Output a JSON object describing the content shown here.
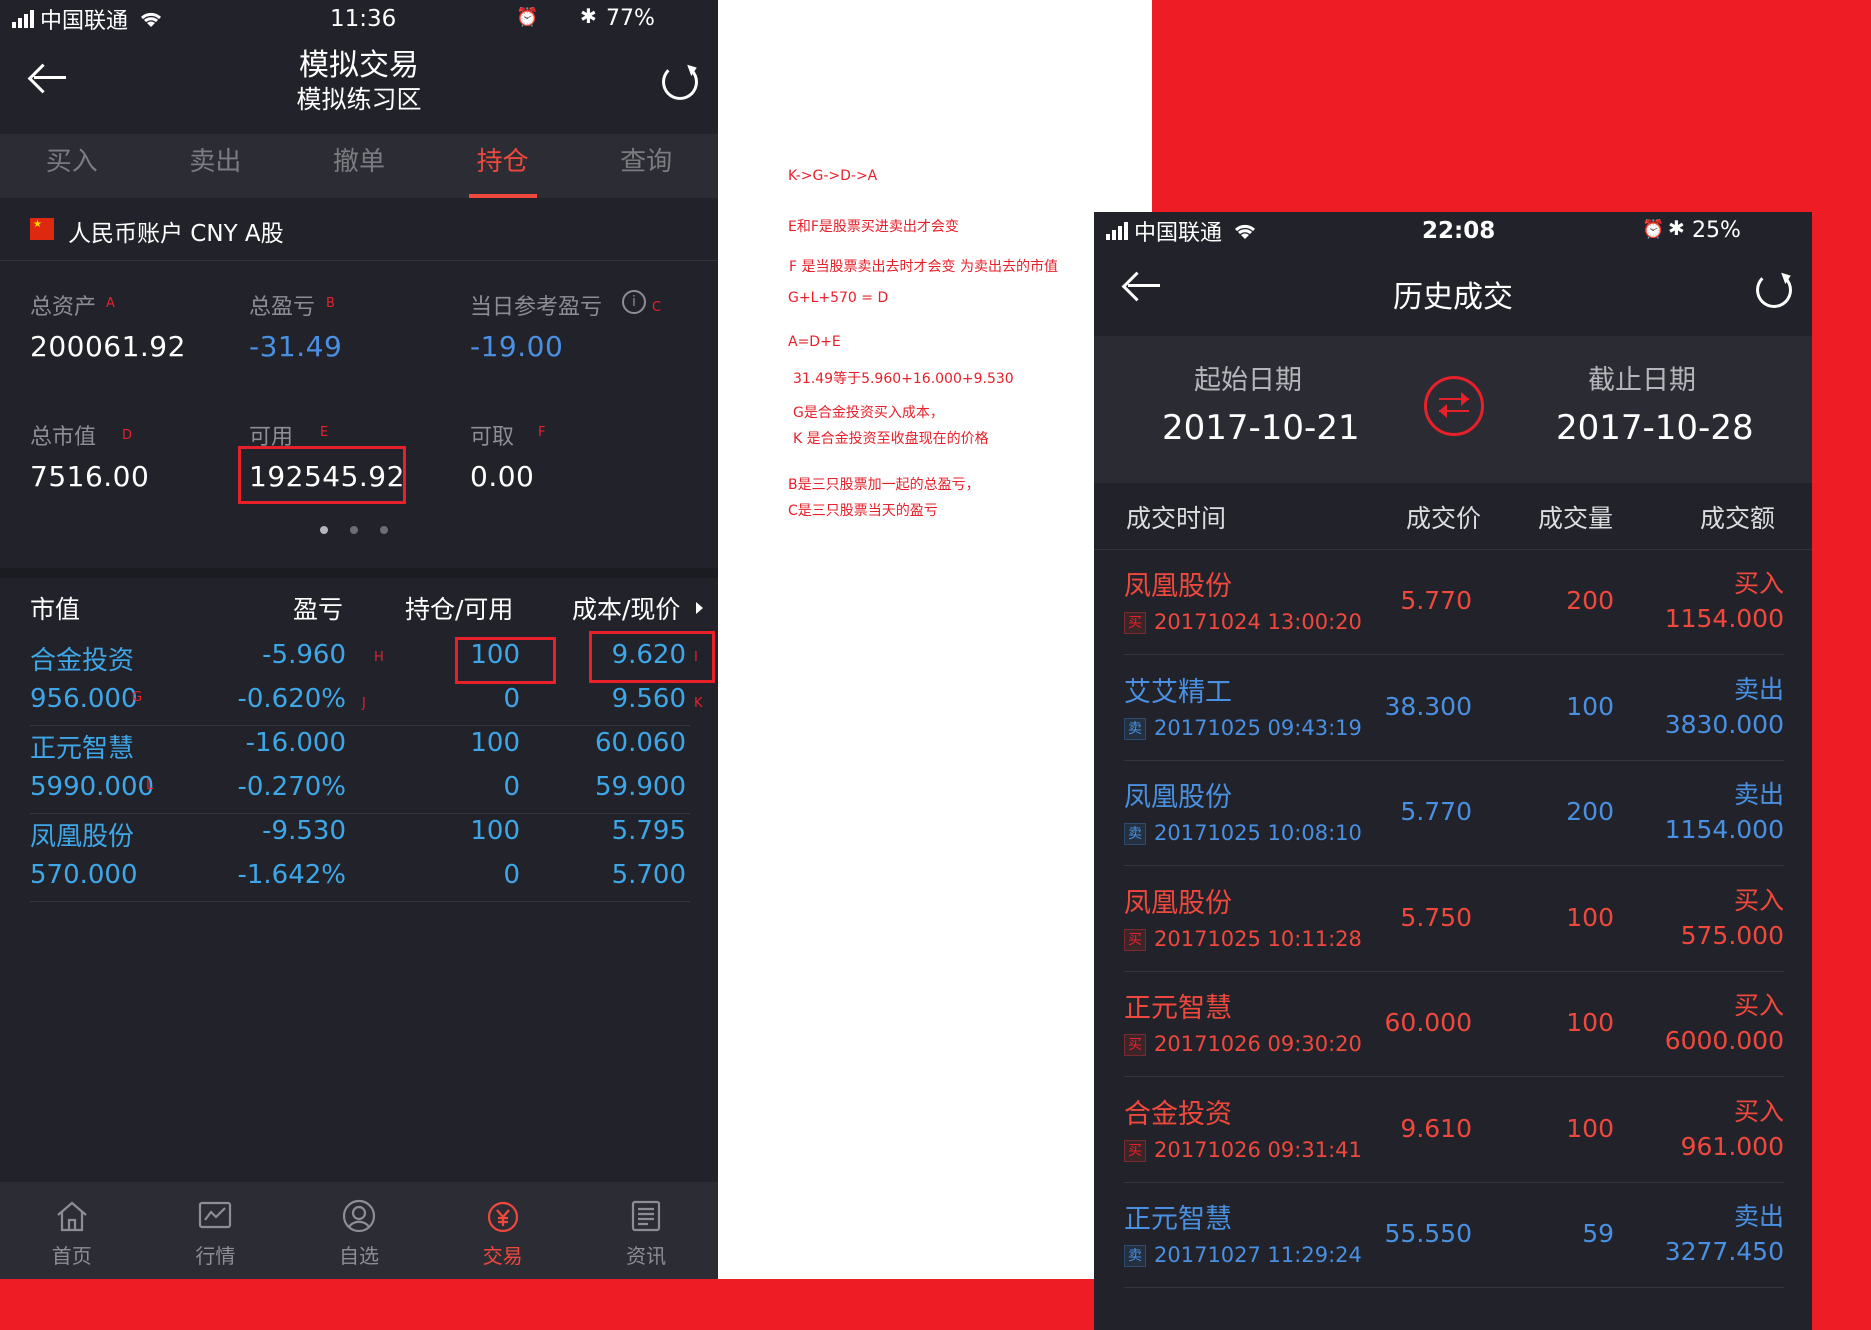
{
  "left": {
    "status": {
      "carrier": "中国联通",
      "time": "11:36",
      "battery": "77%",
      "battery_level": 0.77
    },
    "title": "模拟交易",
    "subtitle": "模拟练习区",
    "tabs": [
      "买入",
      "卖出",
      "撤单",
      "持仓",
      "查询"
    ],
    "active_tab": 3,
    "account": "人民币账户 CNY A股",
    "summary": {
      "total_assets_label": "总资产",
      "total_assets_mark": "A",
      "total_assets": "200061.92",
      "total_pl_label": "总盈亏",
      "total_pl_mark": "B",
      "total_pl": "-31.49",
      "day_pl_label": "当日参考盈亏",
      "day_pl_mark": "C",
      "day_pl": "-19.00",
      "market_value_label": "总市值",
      "market_value_mark": "D",
      "market_value": "7516.00",
      "available_label": "可用",
      "available_mark": "E",
      "available": "192545.92",
      "withdrawable_label": "可取",
      "withdrawable_mark": "F",
      "withdrawable": "0.00"
    },
    "table": {
      "headers": [
        "市值",
        "盈亏",
        "持仓/可用",
        "成本/现价"
      ],
      "rows": [
        {
          "name": "合金投资",
          "mv": "956.000",
          "mv_mark": "G",
          "pl": "-5.960",
          "pl_mark": "H",
          "plpct": "-0.620%",
          "plpct_mark": "J",
          "pos": "100",
          "avail": "0",
          "cost": "9.620",
          "cost_mark": "I",
          "price": "9.560",
          "price_mark": "K"
        },
        {
          "name": "正元智慧",
          "mv": "5990.000",
          "mv_mark": "L",
          "pl": "-16.000",
          "pl_mark": "",
          "plpct": "-0.270%",
          "plpct_mark": "",
          "pos": "100",
          "avail": "0",
          "cost": "60.060",
          "cost_mark": "",
          "price": "59.900",
          "price_mark": ""
        },
        {
          "name": "凤凰股份",
          "mv": "570.000",
          "mv_mark": "",
          "pl": "-9.530",
          "pl_mark": "",
          "plpct": "-1.642%",
          "plpct_mark": "",
          "pos": "100",
          "avail": "0",
          "cost": "5.795",
          "cost_mark": "",
          "price": "5.700",
          "price_mark": ""
        }
      ]
    },
    "nav": [
      "首页",
      "行情",
      "自选",
      "交易",
      "资讯"
    ],
    "active_nav": 3
  },
  "notes": [
    "K->G->D->A",
    "E和F是股票买进卖出才会变",
    "F 是当股票卖出去时才会变 为卖出去的市值",
    "G+L+570 = D",
    "A=D+E",
    "31.49等于5.960+16.000+9.530",
    "G是合金投资买入成本，",
    "K 是合金投资至收盘现在的价格",
    "B是三只股票加一起的总盈亏，",
    "C是三只股票当天的盈亏"
  ],
  "right": {
    "status": {
      "carrier": "中国联通",
      "time": "22:08",
      "battery": "25%",
      "battery_level": 0.25
    },
    "title": "历史成交",
    "start_label": "起始日期",
    "start_date": "2017-10-21",
    "end_label": "截止日期",
    "end_date": "2017-10-28",
    "headers": [
      "成交时间",
      "成交价",
      "成交量",
      "成交额"
    ],
    "rows": [
      {
        "name": "凤凰股份",
        "side_tag": "买",
        "time": "20171024 13:00:20",
        "price": "5.770",
        "qty": "200",
        "side": "买入",
        "amount": "1154.000",
        "color": "red"
      },
      {
        "name": "艾艾精工",
        "side_tag": "卖",
        "time": "20171025 09:43:19",
        "price": "38.300",
        "qty": "100",
        "side": "卖出",
        "amount": "3830.000",
        "color": "blue"
      },
      {
        "name": "凤凰股份",
        "side_tag": "卖",
        "time": "20171025 10:08:10",
        "price": "5.770",
        "qty": "200",
        "side": "卖出",
        "amount": "1154.000",
        "color": "blue"
      },
      {
        "name": "凤凰股份",
        "side_tag": "买",
        "time": "20171025 10:11:28",
        "price": "5.750",
        "qty": "100",
        "side": "买入",
        "amount": "575.000",
        "color": "red"
      },
      {
        "name": "正元智慧",
        "side_tag": "买",
        "time": "20171026 09:30:20",
        "price": "60.000",
        "qty": "100",
        "side": "买入",
        "amount": "6000.000",
        "color": "red"
      },
      {
        "name": "合金投资",
        "side_tag": "买",
        "time": "20171026 09:31:41",
        "price": "9.610",
        "qty": "100",
        "side": "买入",
        "amount": "961.000",
        "color": "red"
      },
      {
        "name": "正元智慧",
        "side_tag": "卖",
        "time": "20171027 11:29:24",
        "price": "55.550",
        "qty": "59",
        "side": "卖出",
        "amount": "3277.450",
        "color": "blue"
      }
    ]
  },
  "colors": {
    "accent_red": "#f0483c",
    "stock_blue": "#3ea7e8",
    "page_red": "#ee1c25",
    "dark_bg": "#22232a"
  }
}
